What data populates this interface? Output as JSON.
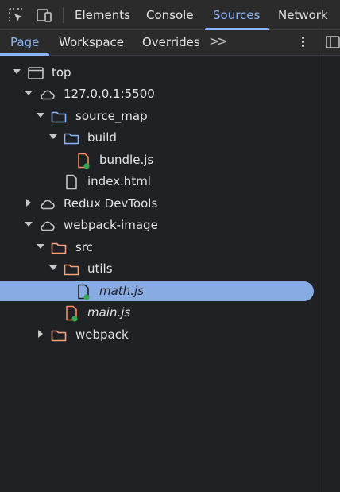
{
  "toolbar": {
    "icons": [
      "inspect-element-icon",
      "device-toolbar-icon"
    ],
    "tabs": [
      "Elements",
      "Console",
      "Sources",
      "Network"
    ],
    "active_tab": "Sources"
  },
  "navigator": {
    "tabs": [
      "Page",
      "Workspace",
      "Overrides"
    ],
    "active_tab": "Page",
    "more_label": ">>"
  },
  "tree": [
    {
      "label": "top",
      "type": "frame",
      "expanded": true
    },
    {
      "label": "127.0.0.1:5500",
      "type": "domain",
      "expanded": true
    },
    {
      "label": "source_map",
      "type": "folder",
      "expanded": true
    },
    {
      "label": "build",
      "type": "folder",
      "expanded": true
    },
    {
      "label": "bundle.js",
      "type": "sourcemap-file"
    },
    {
      "label": "index.html",
      "type": "file"
    },
    {
      "label": "Redux DevTools",
      "type": "domain",
      "expanded": false
    },
    {
      "label": "webpack-image",
      "type": "domain",
      "expanded": true
    },
    {
      "label": "src",
      "type": "folder",
      "expanded": true
    },
    {
      "label": "utils",
      "type": "folder",
      "expanded": true
    },
    {
      "label": "math.js",
      "type": "sourcemap-file",
      "selected": true
    },
    {
      "label": "main.js",
      "type": "sourcemap-file"
    },
    {
      "label": "webpack",
      "type": "folder",
      "expanded": false
    }
  ],
  "colors": {
    "accent": "#8ab4f8",
    "selected_row": "#89abe4",
    "folder_blue": "#8ab4f8",
    "folder_orange": "#f4a27b",
    "js_file": "#f28b54",
    "mapped_dot": "#34a853"
  }
}
